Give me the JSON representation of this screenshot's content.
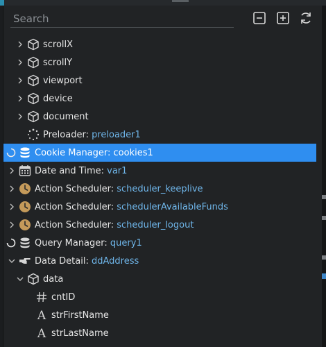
{
  "search": {
    "placeholder": "Search"
  },
  "toolbar": {
    "collapse_icon": "minus-square-icon",
    "expand_icon": "plus-square-icon",
    "refresh_icon": "refresh-icon"
  },
  "colors": {
    "panel_bg": "#212325",
    "selected_bg": "#2f8ef0",
    "value_text": "#6fb6ea",
    "label_text": "#e6e6e6",
    "clock_icon": "#c49a5a"
  },
  "tree": {
    "items": [
      {
        "label": "scrollX",
        "value": "",
        "icon": "cube-icon",
        "expander": "chevron-right"
      },
      {
        "label": "scrollY",
        "value": "",
        "icon": "cube-icon",
        "expander": "chevron-right"
      },
      {
        "label": "viewport",
        "value": "",
        "icon": "cube-icon",
        "expander": "chevron-right"
      },
      {
        "label": "device",
        "value": "",
        "icon": "cube-icon",
        "expander": "chevron-right"
      },
      {
        "label": "document",
        "value": "",
        "icon": "cube-icon",
        "expander": "chevron-right"
      },
      {
        "label": "Preloader: ",
        "value": "preloader1",
        "icon": "dotted-spinner-icon",
        "expander": "none"
      },
      {
        "label": "Cookie Manager: ",
        "value": "cookies1",
        "icon": "database-icon",
        "expander": "spinner",
        "selected": true
      },
      {
        "label": "Date and Time: ",
        "value": "var1",
        "icon": "calendar-icon",
        "expander": "chevron-right"
      },
      {
        "label": "Action Scheduler: ",
        "value": "scheduler_keeplive",
        "icon": "clock-icon",
        "expander": "chevron-right"
      },
      {
        "label": "Action Scheduler: ",
        "value": "schedulerAvailableFunds",
        "icon": "clock-icon",
        "expander": "chevron-right"
      },
      {
        "label": "Action Scheduler: ",
        "value": "scheduler_logout",
        "icon": "clock-icon",
        "expander": "chevron-right"
      },
      {
        "label": "Query Manager: ",
        "value": "query1",
        "icon": "database-icon",
        "expander": "spinner"
      },
      {
        "label": "Data Detail: ",
        "value": "ddAddress",
        "icon": "pointing-hand-icon",
        "expander": "chevron-down"
      },
      {
        "label": "data",
        "value": "",
        "icon": "cube-icon",
        "expander": "chevron-down"
      },
      {
        "label": "cntID",
        "value": "",
        "icon": "hash-icon",
        "expander": "none"
      },
      {
        "label": "strFirstName",
        "value": "",
        "icon": "letter-a-icon",
        "expander": "none"
      },
      {
        "label": "strLastName",
        "value": "",
        "icon": "letter-a-icon",
        "expander": "none"
      }
    ]
  }
}
